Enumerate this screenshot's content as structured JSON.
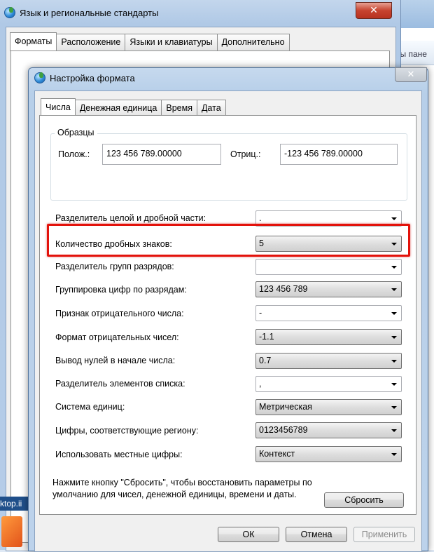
{
  "outer_window": {
    "title": "Язык и региональные стандарты",
    "close_glyph": "✕",
    "tabs": [
      "Форматы",
      "Расположение",
      "Языки и клавиатуры",
      "Дополнительно"
    ]
  },
  "background": {
    "crumb": "ты пане",
    "taskbar_text": "ktop.ii"
  },
  "inner_window": {
    "title": "Настройка формата",
    "close_glyph": "✕",
    "tabs": [
      "Числа",
      "Денежная единица",
      "Время",
      "Дата"
    ],
    "samples": {
      "group_label": "Образцы",
      "positive_label": "Полож.:",
      "positive_value": "123 456 789.00000",
      "negative_label": "Отриц.:",
      "negative_value": "-123 456 789.00000"
    },
    "settings": [
      {
        "label": "Разделитель целой и дробной части:",
        "value": ".",
        "kind": "editable"
      },
      {
        "label": "Количество дробных знаков:",
        "value": "5",
        "kind": "drop"
      },
      {
        "label": "Разделитель групп разрядов:",
        "value": "",
        "kind": "editable"
      },
      {
        "label": "Группировка цифр по разрядам:",
        "value": "123 456 789",
        "kind": "drop"
      },
      {
        "label": "Признак отрицательного числа:",
        "value": "-",
        "kind": "editable"
      },
      {
        "label": "Формат отрицательных чисел:",
        "value": "-1.1",
        "kind": "drop"
      },
      {
        "label": "Вывод нулей в начале числа:",
        "value": "0.7",
        "kind": "drop"
      },
      {
        "label": "Разделитель элементов списка:",
        "value": ",",
        "kind": "editable"
      },
      {
        "label": "Система единиц:",
        "value": "Метрическая",
        "kind": "drop"
      },
      {
        "label": "Цифры, соответствующие региону:",
        "value": "0123456789",
        "kind": "drop"
      },
      {
        "label": "Использовать местные цифры:",
        "value": "Контекст",
        "kind": "drop"
      }
    ],
    "note": "Нажмите кнопку \"Сбросить\", чтобы восстановить параметры по умолчанию для чисел, денежной единицы, времени и даты.",
    "reset_label": "Сбросить",
    "ok_label": "ОК",
    "cancel_label": "Отмена",
    "apply_label": "Применить"
  }
}
